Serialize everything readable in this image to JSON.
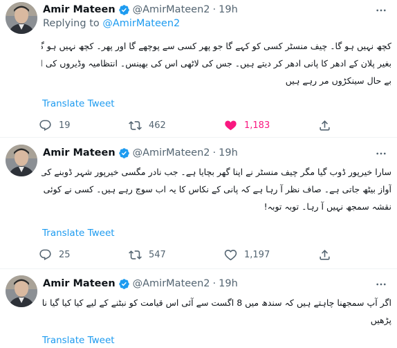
{
  "tweets": [
    {
      "author": {
        "name": "Amir Mateen",
        "handle": "@AmirMateen2",
        "time": "19h"
      },
      "replying_prefix": "Replying to",
      "replying_handle": "@AmirMateen2",
      "body_lines": [
        "کچھ نہیں ہو گا۔ چیف منسٹر کسی کو کہے گا جو پھر کسی سے پوچھے گا اور پھر۔ کچھ نہیں ہو گا۔ کیونکہ ہر وڈیرہ اپنا علاقہ بچا رہا ہے۔",
        "بغیر پلان کے ادھر کا پانی ادھر کر دیتے ہیں۔ جس کی لاٹھی اس کی بھینس۔ انتظامیہ وڈیروں کی اپنی ہے۔ اس میں کروڑوں",
        "بے حال سینکڑوں مر رہے ہیں"
      ],
      "translate": "Translate Tweet",
      "reply_count": "19",
      "retweet_count": "462",
      "like_count": "1,183",
      "liked": true
    },
    {
      "author": {
        "name": "Amir Mateen",
        "handle": "@AmirMateen2",
        "time": "19h"
      },
      "body_lines": [
        "سارا خیرپور ڈوب گیا مگر چیف منسٹر نے اپنا گھر بچایا ہے۔ جب نادر مگسی خیرپور شہر ڈوبنے کی بات کرتا ہے تو مراد علی شاہ کی",
        "آواز بیٹھ جاتی ہے۔ صاف نظر آ رہا ہے کہ پانی کے نکاس کا یہ اب سوچ رہے ہیں۔ کسی نے کوئی بریفنگ نہیں لی۔ کسی کو یہ",
        "نقشہ سمجھ نہیں آ رہا۔ توبہ توبہ!"
      ],
      "translate": "Translate Tweet",
      "reply_count": "25",
      "retweet_count": "547",
      "like_count": "1,197",
      "liked": false
    },
    {
      "author": {
        "name": "Amir Mateen",
        "handle": "@AmirMateen2",
        "time": "19h"
      },
      "body_lines": [
        "اگر آپ سمجھنا چاہتے ہیں کہ سندھ میں 8 اگست سے آئی اس قیامت کو نبٹنے کے لیے کیا کیا گیا ناظر بروہی کے اس تحریر کو",
        "پڑھیں"
      ],
      "translate": "Translate Tweet"
    }
  ],
  "colors": {
    "accent": "#1d9bf0",
    "like": "#f91880",
    "muted": "#536471"
  },
  "icons": [
    "verified-badge-icon",
    "more-icon",
    "reply-icon",
    "retweet-icon",
    "like-icon",
    "share-icon"
  ]
}
